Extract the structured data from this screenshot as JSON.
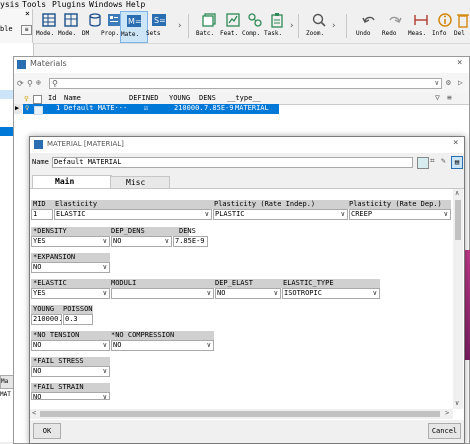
{
  "menubar": {
    "items": [
      "ysis",
      "Tools",
      "Plugins",
      "Windows",
      "Help"
    ]
  },
  "toolbar": {
    "groups": [
      {
        "buttons": [
          {
            "label": "Mode.",
            "icon": "grid-icon"
          },
          {
            "label": "Mode.",
            "icon": "layers-icon"
          },
          {
            "label": "DM",
            "icon": "database-icon"
          },
          {
            "label": "Prop.",
            "icon": "property-icon"
          },
          {
            "label": "Mate.",
            "icon": "material-icon"
          },
          {
            "label": "Sets",
            "icon": "sets-icon"
          }
        ]
      },
      {
        "buttons": [
          {
            "label": "Batc.",
            "icon": "batch-icon"
          },
          {
            "label": "Feat.",
            "icon": "feature-icon"
          },
          {
            "label": "Comp.",
            "icon": "component-icon"
          },
          {
            "label": "Task.",
            "icon": "task-icon"
          }
        ]
      },
      {
        "buttons": [
          {
            "label": "Zoom.",
            "icon": "zoom-icon"
          }
        ]
      },
      {
        "buttons": [
          {
            "label": "Undo",
            "icon": "undo-icon"
          },
          {
            "label": "Redo",
            "icon": "redo-icon"
          },
          {
            "label": "Meas.",
            "icon": "measure-icon"
          },
          {
            "label": "Info",
            "icon": "info-icon"
          },
          {
            "label": "Del",
            "icon": "delete-icon"
          }
        ]
      }
    ]
  },
  "left_panel": {
    "close": "×",
    "partial_label": "ble",
    "bottom_tab": "Ma",
    "bottom_tab2": "MAT"
  },
  "materials": {
    "title": "Materials",
    "columns": [
      "Id",
      "Name",
      "DEFINED",
      "YOUNG",
      "DENS",
      "__type__"
    ],
    "row": {
      "id": "1",
      "name": "Default MATE···",
      "defined": "☑",
      "young": "210000.",
      "dens": "7.85E-9",
      "type": "MATERIAL"
    }
  },
  "dialog": {
    "title": "MATERIAL [MATERIAL]",
    "name_label": "Name",
    "name_value": "Default MATERIAL",
    "tabs": [
      "Main",
      "Misc"
    ],
    "row1": {
      "headers": [
        "MID",
        "Elasticity",
        "Plasticity (Rate Indep.)",
        "Plasticity (Rate Dep.)"
      ],
      "values": [
        "1",
        "ELASTIC",
        "PLASTIC",
        "CREEP"
      ]
    },
    "density": {
      "headers": [
        "*DENSITY",
        "DEP_DENS",
        "DENS"
      ],
      "values": [
        "YES",
        "NO",
        "7.85E-9"
      ]
    },
    "expansion": {
      "header": "*EXPANSION",
      "value": "NO"
    },
    "elastic": {
      "headers": [
        "*ELASTIC",
        "MODULI",
        "DEP_ELAST",
        "ELASTIC_TYPE"
      ],
      "values": [
        "YES",
        "",
        "NO",
        "ISOTROPIC"
      ]
    },
    "young": {
      "headers": [
        "YOUNG",
        "POISSON"
      ],
      "values": [
        "210000.",
        "0.3"
      ]
    },
    "tension": {
      "headers": [
        "*NO TENSION",
        "*NO COMPRESSION"
      ],
      "values": [
        "NO",
        "NO"
      ]
    },
    "fail_stress": {
      "header": "*FAIL STRESS",
      "value": "NO"
    },
    "fail_strain": {
      "header": "*FAIL STRAIN",
      "value": "NO"
    },
    "ok": "OK",
    "cancel": "Cancel"
  }
}
